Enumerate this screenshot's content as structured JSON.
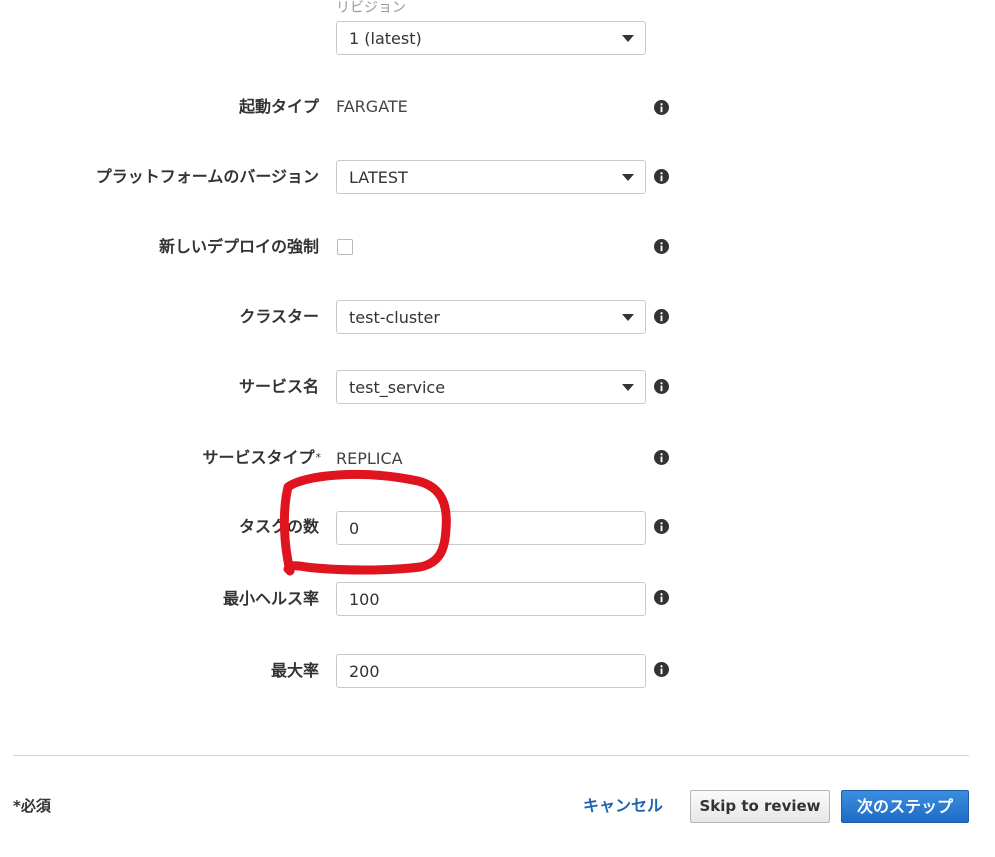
{
  "revision": {
    "label": "リビジョン",
    "value": "1 (latest)"
  },
  "launch_type": {
    "label": "起動タイプ",
    "value": "FARGATE"
  },
  "platform_version": {
    "label": "プラットフォームのバージョン",
    "value": "LATEST"
  },
  "force_new_deployment": {
    "label": "新しいデプロイの強制",
    "checked": false
  },
  "cluster": {
    "label": "クラスター",
    "value": "test-cluster"
  },
  "service_name": {
    "label": "サービス名",
    "value": "test_service"
  },
  "service_type": {
    "label": "サービスタイプ",
    "required_mark": "*",
    "value": "REPLICA"
  },
  "task_count": {
    "label": "タスクの数",
    "value": "0"
  },
  "min_healthy_percent": {
    "label": "最小ヘルス率",
    "value": "100"
  },
  "max_percent": {
    "label": "最大率",
    "value": "200"
  },
  "footer": {
    "required_note": "*必須",
    "cancel_label": "キャンセル",
    "skip_label": "Skip to review",
    "next_label": "次のステップ"
  },
  "colors": {
    "primary_button": "#1e6cc4",
    "link": "#1f66b0",
    "annotation": "#e0141e"
  },
  "icons": {
    "info": "info-icon",
    "dropdown": "caret-down-icon"
  }
}
